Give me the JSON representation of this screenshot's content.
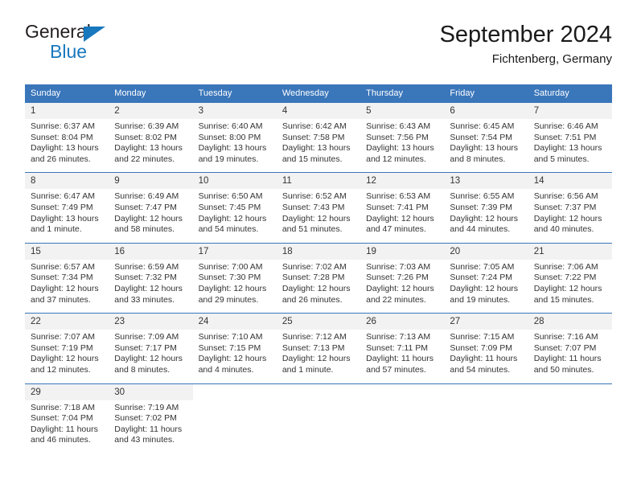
{
  "brand": {
    "logo_top": "General",
    "logo_bottom": "Blue",
    "logo_triangle_color": "#1878be"
  },
  "header": {
    "title": "September 2024",
    "subtitle": "Fichtenberg, Germany"
  },
  "theme": {
    "header_bg": "#3a76ba",
    "header_text": "#ffffff",
    "daynum_bg": "#f2f2f2",
    "grid_line": "#3a76ba",
    "body_text": "#333333"
  },
  "weekday_headers": [
    "Sunday",
    "Monday",
    "Tuesday",
    "Wednesday",
    "Thursday",
    "Friday",
    "Saturday"
  ],
  "weeks": [
    [
      {
        "day": "1",
        "sunrise": "Sunrise: 6:37 AM",
        "sunset": "Sunset: 8:04 PM",
        "daylight1": "Daylight: 13 hours",
        "daylight2": "and 26 minutes."
      },
      {
        "day": "2",
        "sunrise": "Sunrise: 6:39 AM",
        "sunset": "Sunset: 8:02 PM",
        "daylight1": "Daylight: 13 hours",
        "daylight2": "and 22 minutes."
      },
      {
        "day": "3",
        "sunrise": "Sunrise: 6:40 AM",
        "sunset": "Sunset: 8:00 PM",
        "daylight1": "Daylight: 13 hours",
        "daylight2": "and 19 minutes."
      },
      {
        "day": "4",
        "sunrise": "Sunrise: 6:42 AM",
        "sunset": "Sunset: 7:58 PM",
        "daylight1": "Daylight: 13 hours",
        "daylight2": "and 15 minutes."
      },
      {
        "day": "5",
        "sunrise": "Sunrise: 6:43 AM",
        "sunset": "Sunset: 7:56 PM",
        "daylight1": "Daylight: 13 hours",
        "daylight2": "and 12 minutes."
      },
      {
        "day": "6",
        "sunrise": "Sunrise: 6:45 AM",
        "sunset": "Sunset: 7:54 PM",
        "daylight1": "Daylight: 13 hours",
        "daylight2": "and 8 minutes."
      },
      {
        "day": "7",
        "sunrise": "Sunrise: 6:46 AM",
        "sunset": "Sunset: 7:51 PM",
        "daylight1": "Daylight: 13 hours",
        "daylight2": "and 5 minutes."
      }
    ],
    [
      {
        "day": "8",
        "sunrise": "Sunrise: 6:47 AM",
        "sunset": "Sunset: 7:49 PM",
        "daylight1": "Daylight: 13 hours",
        "daylight2": "and 1 minute."
      },
      {
        "day": "9",
        "sunrise": "Sunrise: 6:49 AM",
        "sunset": "Sunset: 7:47 PM",
        "daylight1": "Daylight: 12 hours",
        "daylight2": "and 58 minutes."
      },
      {
        "day": "10",
        "sunrise": "Sunrise: 6:50 AM",
        "sunset": "Sunset: 7:45 PM",
        "daylight1": "Daylight: 12 hours",
        "daylight2": "and 54 minutes."
      },
      {
        "day": "11",
        "sunrise": "Sunrise: 6:52 AM",
        "sunset": "Sunset: 7:43 PM",
        "daylight1": "Daylight: 12 hours",
        "daylight2": "and 51 minutes."
      },
      {
        "day": "12",
        "sunrise": "Sunrise: 6:53 AM",
        "sunset": "Sunset: 7:41 PM",
        "daylight1": "Daylight: 12 hours",
        "daylight2": "and 47 minutes."
      },
      {
        "day": "13",
        "sunrise": "Sunrise: 6:55 AM",
        "sunset": "Sunset: 7:39 PM",
        "daylight1": "Daylight: 12 hours",
        "daylight2": "and 44 minutes."
      },
      {
        "day": "14",
        "sunrise": "Sunrise: 6:56 AM",
        "sunset": "Sunset: 7:37 PM",
        "daylight1": "Daylight: 12 hours",
        "daylight2": "and 40 minutes."
      }
    ],
    [
      {
        "day": "15",
        "sunrise": "Sunrise: 6:57 AM",
        "sunset": "Sunset: 7:34 PM",
        "daylight1": "Daylight: 12 hours",
        "daylight2": "and 37 minutes."
      },
      {
        "day": "16",
        "sunrise": "Sunrise: 6:59 AM",
        "sunset": "Sunset: 7:32 PM",
        "daylight1": "Daylight: 12 hours",
        "daylight2": "and 33 minutes."
      },
      {
        "day": "17",
        "sunrise": "Sunrise: 7:00 AM",
        "sunset": "Sunset: 7:30 PM",
        "daylight1": "Daylight: 12 hours",
        "daylight2": "and 29 minutes."
      },
      {
        "day": "18",
        "sunrise": "Sunrise: 7:02 AM",
        "sunset": "Sunset: 7:28 PM",
        "daylight1": "Daylight: 12 hours",
        "daylight2": "and 26 minutes."
      },
      {
        "day": "19",
        "sunrise": "Sunrise: 7:03 AM",
        "sunset": "Sunset: 7:26 PM",
        "daylight1": "Daylight: 12 hours",
        "daylight2": "and 22 minutes."
      },
      {
        "day": "20",
        "sunrise": "Sunrise: 7:05 AM",
        "sunset": "Sunset: 7:24 PM",
        "daylight1": "Daylight: 12 hours",
        "daylight2": "and 19 minutes."
      },
      {
        "day": "21",
        "sunrise": "Sunrise: 7:06 AM",
        "sunset": "Sunset: 7:22 PM",
        "daylight1": "Daylight: 12 hours",
        "daylight2": "and 15 minutes."
      }
    ],
    [
      {
        "day": "22",
        "sunrise": "Sunrise: 7:07 AM",
        "sunset": "Sunset: 7:19 PM",
        "daylight1": "Daylight: 12 hours",
        "daylight2": "and 12 minutes."
      },
      {
        "day": "23",
        "sunrise": "Sunrise: 7:09 AM",
        "sunset": "Sunset: 7:17 PM",
        "daylight1": "Daylight: 12 hours",
        "daylight2": "and 8 minutes."
      },
      {
        "day": "24",
        "sunrise": "Sunrise: 7:10 AM",
        "sunset": "Sunset: 7:15 PM",
        "daylight1": "Daylight: 12 hours",
        "daylight2": "and 4 minutes."
      },
      {
        "day": "25",
        "sunrise": "Sunrise: 7:12 AM",
        "sunset": "Sunset: 7:13 PM",
        "daylight1": "Daylight: 12 hours",
        "daylight2": "and 1 minute."
      },
      {
        "day": "26",
        "sunrise": "Sunrise: 7:13 AM",
        "sunset": "Sunset: 7:11 PM",
        "daylight1": "Daylight: 11 hours",
        "daylight2": "and 57 minutes."
      },
      {
        "day": "27",
        "sunrise": "Sunrise: 7:15 AM",
        "sunset": "Sunset: 7:09 PM",
        "daylight1": "Daylight: 11 hours",
        "daylight2": "and 54 minutes."
      },
      {
        "day": "28",
        "sunrise": "Sunrise: 7:16 AM",
        "sunset": "Sunset: 7:07 PM",
        "daylight1": "Daylight: 11 hours",
        "daylight2": "and 50 minutes."
      }
    ],
    [
      {
        "day": "29",
        "sunrise": "Sunrise: 7:18 AM",
        "sunset": "Sunset: 7:04 PM",
        "daylight1": "Daylight: 11 hours",
        "daylight2": "and 46 minutes."
      },
      {
        "day": "30",
        "sunrise": "Sunrise: 7:19 AM",
        "sunset": "Sunset: 7:02 PM",
        "daylight1": "Daylight: 11 hours",
        "daylight2": "and 43 minutes."
      },
      {
        "day": "",
        "sunrise": "",
        "sunset": "",
        "daylight1": "",
        "daylight2": ""
      },
      {
        "day": "",
        "sunrise": "",
        "sunset": "",
        "daylight1": "",
        "daylight2": ""
      },
      {
        "day": "",
        "sunrise": "",
        "sunset": "",
        "daylight1": "",
        "daylight2": ""
      },
      {
        "day": "",
        "sunrise": "",
        "sunset": "",
        "daylight1": "",
        "daylight2": ""
      },
      {
        "day": "",
        "sunrise": "",
        "sunset": "",
        "daylight1": "",
        "daylight2": ""
      }
    ]
  ]
}
